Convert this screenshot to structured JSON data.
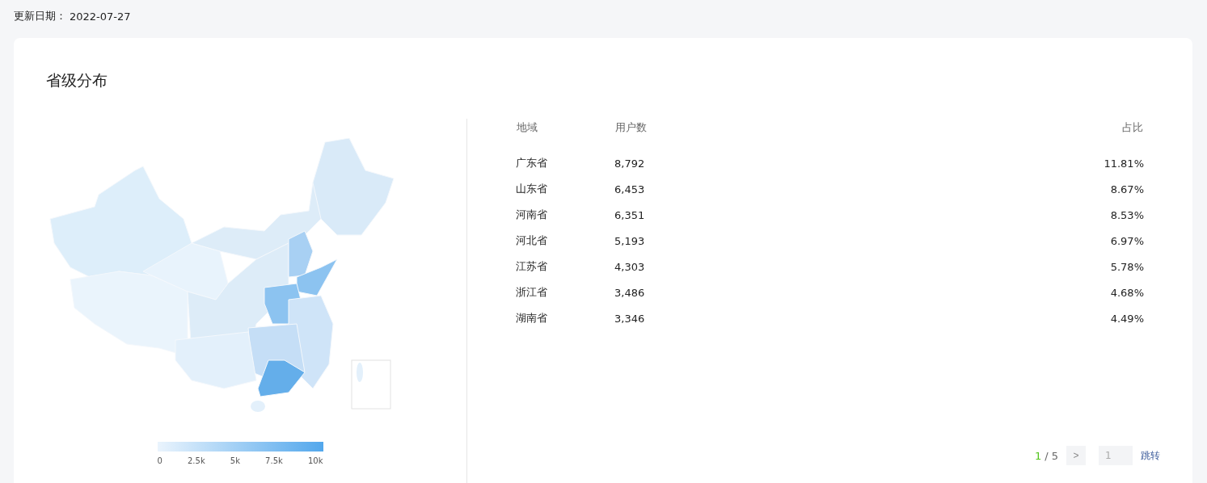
{
  "update": {
    "label": "更新日期：",
    "date": "2022-07-27"
  },
  "card": {
    "title": "省级分布",
    "legend": {
      "labels": [
        "0",
        "2.5k",
        "5k",
        "7.5k",
        "10k"
      ]
    },
    "table": {
      "columns": [
        "地域",
        "用户数",
        "占比"
      ],
      "rows": [
        {
          "region": "广东省",
          "users": "8,792",
          "share": "11.81%"
        },
        {
          "region": "山东省",
          "users": "6,453",
          "share": "8.67%"
        },
        {
          "region": "河南省",
          "users": "6,351",
          "share": "8.53%"
        },
        {
          "region": "河北省",
          "users": "5,193",
          "share": "6.97%"
        },
        {
          "region": "江苏省",
          "users": "4,303",
          "share": "5.78%"
        },
        {
          "region": "浙江省",
          "users": "3,486",
          "share": "4.68%"
        },
        {
          "region": "湖南省",
          "users": "3,346",
          "share": "4.49%"
        }
      ]
    },
    "pagination": {
      "current": "1",
      "total": "/ 5",
      "next": ">",
      "jump_value": "1",
      "jump_label": "跳转"
    }
  }
}
